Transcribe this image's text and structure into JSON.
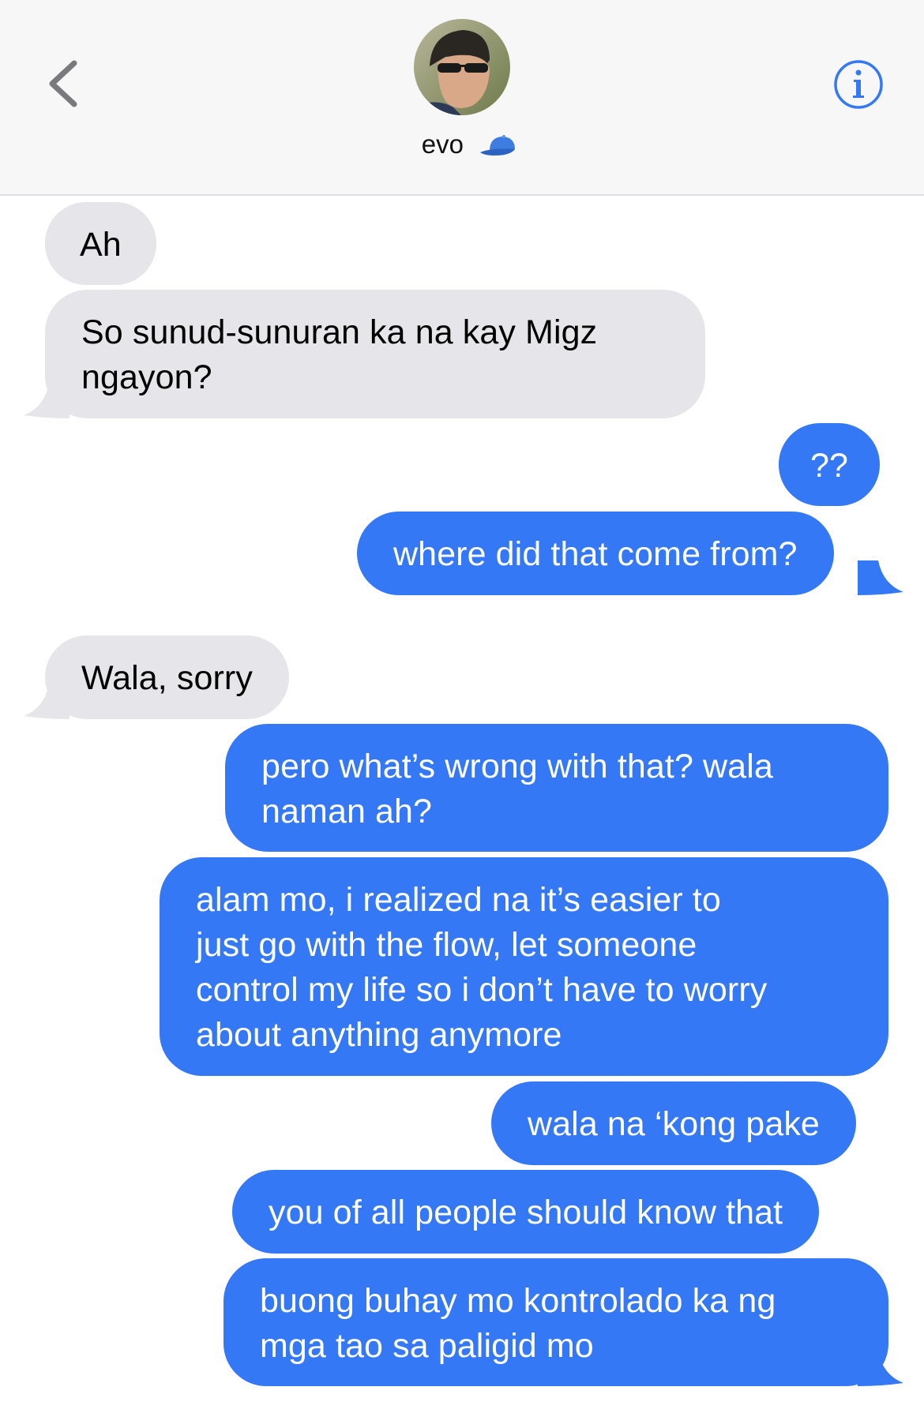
{
  "header": {
    "contact_name": "evo",
    "contact_emoji": "billed-cap-icon",
    "back_icon": "chevron-left-icon",
    "info_icon": "info-icon"
  },
  "colors": {
    "sent_bubble": "#3478f6",
    "received_bubble": "#e5e5ea",
    "header_bg": "#f7f7f7",
    "accent": "#3478f6"
  },
  "messages": [
    {
      "direction": "received",
      "text": "Ah"
    },
    {
      "direction": "received",
      "text": "So sunud-sunuran ka na kay Migz\nngayon?"
    },
    {
      "direction": "sent",
      "text": "??"
    },
    {
      "direction": "sent",
      "text": "where did that come from?"
    },
    {
      "direction": "received",
      "text": "Wala, sorry"
    },
    {
      "direction": "sent",
      "text": "pero what’s wrong with that? wala\nnaman ah?"
    },
    {
      "direction": "sent",
      "text": "alam mo, i realized na it’s easier to\njust go with the flow, let someone\ncontrol my life so i don’t have to worry\nabout anything anymore"
    },
    {
      "direction": "sent",
      "text": "wala na ‘kong pake"
    },
    {
      "direction": "sent",
      "text": "you of all people should know that"
    },
    {
      "direction": "sent",
      "text": "buong buhay mo kontrolado ka ng\nmga tao sa paligid mo"
    }
  ]
}
